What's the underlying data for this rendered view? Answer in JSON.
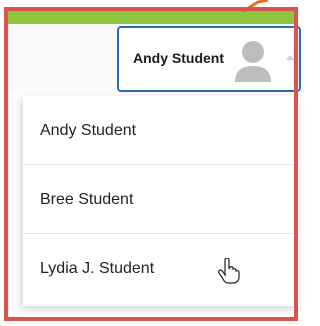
{
  "profile_selector": {
    "selected_name": "Andy Student",
    "avatar_icon": "user-avatar-icon",
    "caret_icon": "caret-up-icon"
  },
  "menu": {
    "items": [
      {
        "label": "Andy Student"
      },
      {
        "label": "Bree Student"
      },
      {
        "label": "Lydia J. Student"
      }
    ]
  },
  "colors": {
    "highlight_frame": "#d9534f",
    "selector_border": "#2a6db0",
    "top_bar": "#8fc63f"
  },
  "cursor_icon": "hand-pointer-icon"
}
